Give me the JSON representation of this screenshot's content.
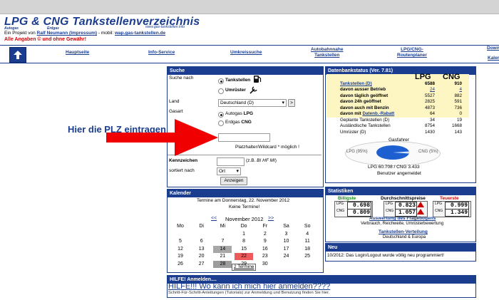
{
  "header": {
    "logo_main": "LPG & CNG Tankstellenverzeichnis",
    "logo_autogas": "Autogas",
    "logo_erdgas": "Erdgas",
    "logo_url": "www.gas-tankstellen.info",
    "project_prefix": "Ein Projekt von ",
    "project_author": "Ralf Neumann (Impressum)",
    "project_mobile_prefix": " - mobil: ",
    "project_mobile_url": "wap.gas-tankstellen.de",
    "warning": "Alle Angaben © und ohne Gewähr!"
  },
  "nav": {
    "items": [
      {
        "label": "Hauptseite"
      },
      {
        "label": "Info-Service"
      },
      {
        "label": "Umkreissuche"
      },
      {
        "label": "Autobahnnahe\nTankstellen"
      },
      {
        "label": "LPG/CNG-\nRoutenplaner"
      },
      {
        "label": "Downl"
      },
      {
        "label": "Kalen"
      }
    ]
  },
  "annotation": {
    "text": "Hier die PLZ eintragen"
  },
  "search": {
    "title": "Suche",
    "suche_nach_label": "Suche nach",
    "opt_tankstellen": "Tankstellen",
    "opt_umruester": "Umrüster",
    "land_label": "Land",
    "land_value": "Deutschland (D)",
    "land_btn": ">",
    "gasart_label": "Gasart",
    "gas_lpg_prefix": "Autogas ",
    "gas_lpg": "LPG",
    "gas_cng_prefix": "Erdgas ",
    "gas_cng": "CNG",
    "plz_value": "",
    "wildcard_text": "Platzhalter/Wildcard * möglich !",
    "kennzeichen_label": "Kennzeichen",
    "kennzeichen_hint_prefix": "(z.B. ",
    "kennzeichen_hint_italic": "BI HF MI",
    "kennzeichen_hint_suffix": ")",
    "sort_label": "sortiert nach",
    "sort_value": "Ort",
    "submit": "Anzeigen"
  },
  "calendar": {
    "title": "Kalender",
    "info_line1": "Termine am Donnerstag, 22. November 2012",
    "info_line2": "Keine Termine!",
    "prev": "<<",
    "month": "November 2012",
    "next": ">>",
    "weekdays": [
      "Mo",
      "Di",
      "Mi",
      "Do",
      "Fr",
      "Sa",
      "So"
    ],
    "weeks": [
      [
        "",
        "",
        "",
        "1",
        "2",
        "3",
        "4"
      ],
      [
        "5",
        "6",
        "7",
        "8",
        "9",
        "10",
        "11"
      ],
      [
        "12",
        "13",
        "14",
        "15",
        "16",
        "17",
        "18"
      ],
      [
        "19",
        "20",
        "21",
        "22",
        "23",
        "24",
        "25"
      ],
      [
        "26",
        "27",
        "28",
        "29",
        "30",
        "",
        ""
      ]
    ],
    "termine_link": "2 Termine"
  },
  "datenbank": {
    "title": "Datenbankstatus (Ver. 7.81)",
    "col_lpg": "LPG",
    "col_cng": "CNG",
    "rows": [
      {
        "label": "Tankstellen (D)",
        "lpg": "6588",
        "cng": "910",
        "style": "link-bold"
      },
      {
        "label": "davon ausser Betrieb",
        "lpg": "24",
        "cng": "4",
        "style": "bold-linkval"
      },
      {
        "label": "davon täglich geöffnet",
        "lpg": "5527",
        "cng": "882",
        "style": "bold"
      },
      {
        "label": "davon 24h geöffnet",
        "lpg": "2825",
        "cng": "591",
        "style": "bold"
      },
      {
        "label": "davon auch mit Benzin",
        "lpg": "4873",
        "cng": "736",
        "style": "bold"
      },
      {
        "label": "davon mit ",
        "label_link": "Datenb.-Rabatt",
        "lpg": "64",
        "cng": "0",
        "style": "bold"
      },
      {
        "label": "Geplante Tankstellen (D)",
        "lpg": "34",
        "cng": "19",
        "style": "plain"
      },
      {
        "label": "Ausländische Tankstellen",
        "lpg": "8754",
        "cng": "1668",
        "style": "plain"
      },
      {
        "label": "Umrüster (D)",
        "lpg": "1430",
        "cng": "143",
        "style": "plain"
      }
    ],
    "gasfahrer_label": "Gasfahrer",
    "pie_lpg_label": "LPG (95%)",
    "pie_cng_label": "CNG (5%)",
    "pie_lpg_share": 95,
    "pie_cng_share": 5,
    "totals": "LPG 60.708 / CNG 3.433",
    "logged_in": "Benutzer angemeldet"
  },
  "statistiken": {
    "title": "Statistiken",
    "billigste_label": "Billigste",
    "durchschnitt_label": "Durchschnittspreise",
    "teuerste_label": "Teuerste",
    "billigste": [
      "0.698",
      "0.809"
    ],
    "durchschnitt": [
      "0.823",
      "1.057"
    ],
    "teuerste": [
      "0.999",
      "1.349"
    ],
    "auswertung_link": "Auswertung des Fragebogens",
    "auswertung_sub": "Verbrauch, Reichweite, Umrüsterbewertung",
    "verteilung_link": "Tankstellen-Verteilung",
    "verteilung_sub": "Deutschland & Europa",
    "colors": {
      "billigste": "#1a8a1a",
      "teuerste": "#d00000"
    }
  },
  "neu": {
    "title": "Neu",
    "text": "10/2012: Das Login/Logout wurde völlig neu programmiert!"
  },
  "hilfe": {
    "title": "HILFE! Anmelden....",
    "big_link": "HILFE!!! Wo kann ich mich hier anmelden????",
    "small_text": "Schritt-Für-Schritt-Anleitungen (Tutorials) zur Anmeldung und Benutzung finden Sie hier."
  },
  "colors": {
    "brand": "#1a3d8f",
    "arrow": "#f00000"
  }
}
